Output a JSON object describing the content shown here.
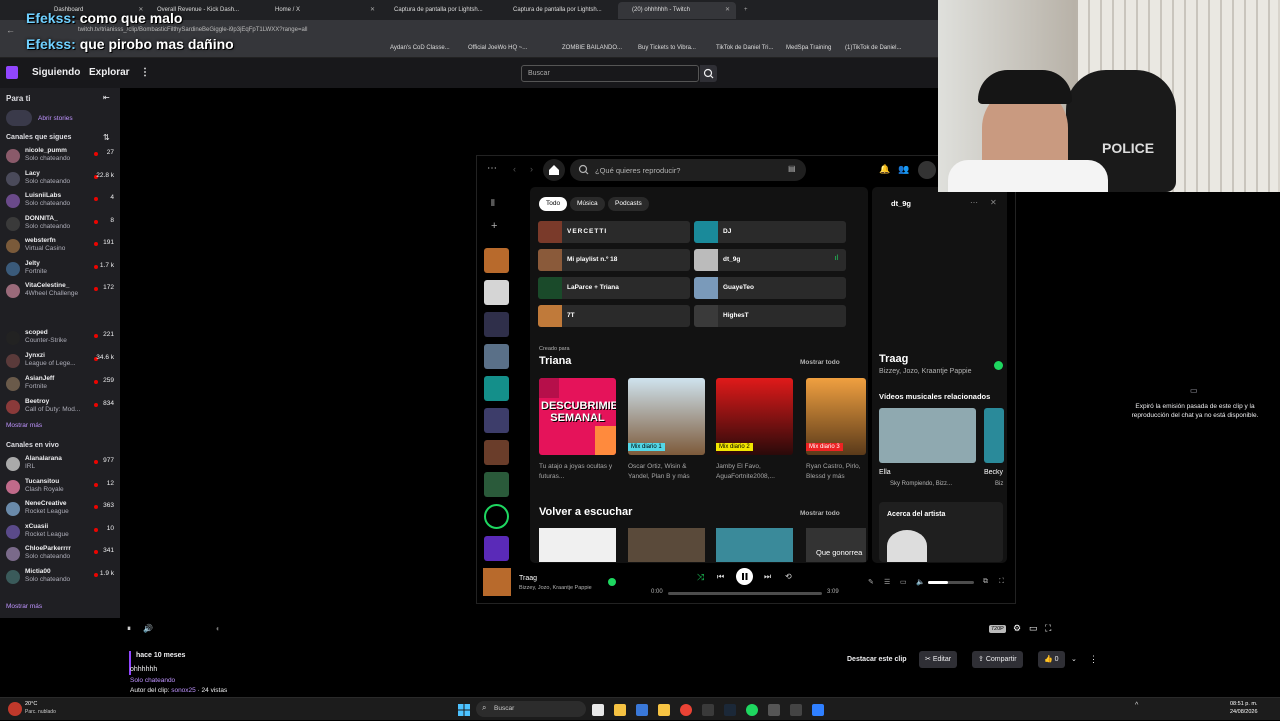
{
  "overlay_chat": [
    {
      "user": "Efekss:",
      "text": "como que malo"
    },
    {
      "user": "Efekss:",
      "text": "que pirobo mas dañino"
    }
  ],
  "browser": {
    "tabs": [
      "Dashboard",
      "Overall Revenue - Kick Dash...",
      "Home / X",
      "Captura de pantalla por Lightsh...",
      "Captura de pantalla por Lightsh...",
      "(20) ohhhhhh - Twitch"
    ],
    "url": "twitch.tv/trianisss_/clip/BombasticFilthySardineBeGiggle-i9p3jEqFpT1LWXX?range=all",
    "bookmarks": [
      "Aydan's CoD Classe...",
      "Official JoeWo HQ ~...",
      "ZOMBIE BAILANDO...",
      "Buy Tickets to Vibra...",
      "TikTok de Daniel Tri...",
      "MedSpa Training",
      "(1)TikTok de Daniel..."
    ]
  },
  "twitch": {
    "nav": {
      "following": "Siguiendo",
      "explore": "Explorar",
      "search_placeholder": "Buscar"
    },
    "sidebar": {
      "for_you": "Para ti",
      "stories": "Abrir stories",
      "followed_header": "Canales que sigues",
      "followed": [
        {
          "name": "nicole_pumm",
          "game": "Solo chateando",
          "viewers": "27"
        },
        {
          "name": "Lacy",
          "game": "Solo chateando",
          "viewers": "22.8 k"
        },
        {
          "name": "LuisniiLabs",
          "game": "Solo chateando",
          "viewers": "4"
        },
        {
          "name": "DONNITA_",
          "game": "Solo chateando",
          "viewers": "8"
        },
        {
          "name": "websterfn",
          "game": "Virtual Casino",
          "viewers": "191"
        },
        {
          "name": "Jelty",
          "game": "Fortnite",
          "viewers": "1.7 k"
        },
        {
          "name": "VitaCelestine_",
          "game": "4Wheel Challenge",
          "viewers": "172"
        },
        {
          "name": "scoped",
          "game": "Counter-Strike",
          "viewers": "221"
        },
        {
          "name": "Jynxzi",
          "game": "League of Lege...",
          "viewers": "34.6 k"
        },
        {
          "name": "AsianJeff",
          "game": "Fortnite",
          "viewers": "259"
        },
        {
          "name": "Beetroy",
          "game": "Call of Duty: Mod...",
          "viewers": "834"
        }
      ],
      "show_more": "Mostrar más",
      "live_header": "Canales en vivo",
      "live": [
        {
          "name": "Alanalarana",
          "game": "IRL",
          "viewers": "977"
        },
        {
          "name": "Tucansitou",
          "game": "Clash Royale",
          "viewers": "12"
        },
        {
          "name": "NeneCreative",
          "game": "Rocket League",
          "viewers": "363"
        },
        {
          "name": "xCuasii",
          "game": "Rocket League",
          "viewers": "10"
        },
        {
          "name": "ChloeParkerrrr",
          "game": "Solo chateando",
          "viewers": "341"
        },
        {
          "name": "Mictia00",
          "game": "Solo chateando",
          "viewers": "1.9 k"
        }
      ],
      "show_more_2": "Mostrar más"
    },
    "offline_msg": "Expiró la emisión pasada de este clip y la reproducción del chat ya no está disponible.",
    "clip": {
      "age": "hace 10 meses",
      "title": "ohhhhhh",
      "category": "Solo chateando",
      "author_prefix": "Autor del clip:",
      "author": "sonox25",
      "views": " · 24 vistas",
      "highlight": "Destacar este clip",
      "edit": "Editar",
      "share": "Compartir",
      "likes": "0",
      "quality": "720P"
    }
  },
  "spotify": {
    "search_placeholder": "¿Qué quieres reproducir?",
    "chips": [
      "Todo",
      "Música",
      "Podcasts"
    ],
    "quick": [
      "VERCETTI",
      "DJ",
      "Mi playlist n.º 18",
      "dt_9g",
      "LaParce + Triana",
      "GuayeTeo",
      "7T",
      "HighesT"
    ],
    "made_for": "Creado para",
    "made_for_user": "Triana",
    "show_all": "Mostrar todo",
    "cards": [
      {
        "tag": "",
        "art": "DESCUBRIMIENTO SEMANAL",
        "caption": "Tu atajo a joyas ocultas y futuras..."
      },
      {
        "tag": "Mix diario 1",
        "art": "",
        "caption": "Oscar Ortiz, Wisin & Yandel, Plan B y más"
      },
      {
        "tag": "Mix diario 2",
        "art": "",
        "caption": "Jamby El Favo, AguaFortnite2008,..."
      },
      {
        "tag": "Mix diario 3",
        "art": "",
        "caption": "Ryan Castro, Pirlo, Blessd y más"
      }
    ],
    "recent_title": "Volver a escuchar",
    "recent_tile_text": "Que gonorrea",
    "right_panel": {
      "playlist": "dt_9g",
      "track": "Traag",
      "artists": "Bizzey, Jozo, Kraantje Pappie",
      "related_title": "Vídeos musicales relacionados",
      "related": [
        {
          "title": "Ella",
          "sub": "Sky Rompiendo, Bizz..."
        },
        {
          "title": "Becky",
          "sub": "Biz"
        }
      ],
      "about": "Acerca del artista"
    },
    "now_playing": {
      "track": "Traag",
      "artists": "Bizzey, Jozo, Kraantje Pappie",
      "elapsed": "0:00",
      "duration": "3:09",
      "progress": 0.0
    }
  },
  "webcam_text": "POLICE",
  "taskbar": {
    "weather_temp": "20°C",
    "weather_desc": "Parc. nublado",
    "search": "Buscar",
    "time": "08:51 p. m.",
    "date": "24/08/2026"
  },
  "colors": {
    "twitch_purple": "#9146ff",
    "spotify_green": "#1ed760",
    "live_red": "#eb0400"
  }
}
